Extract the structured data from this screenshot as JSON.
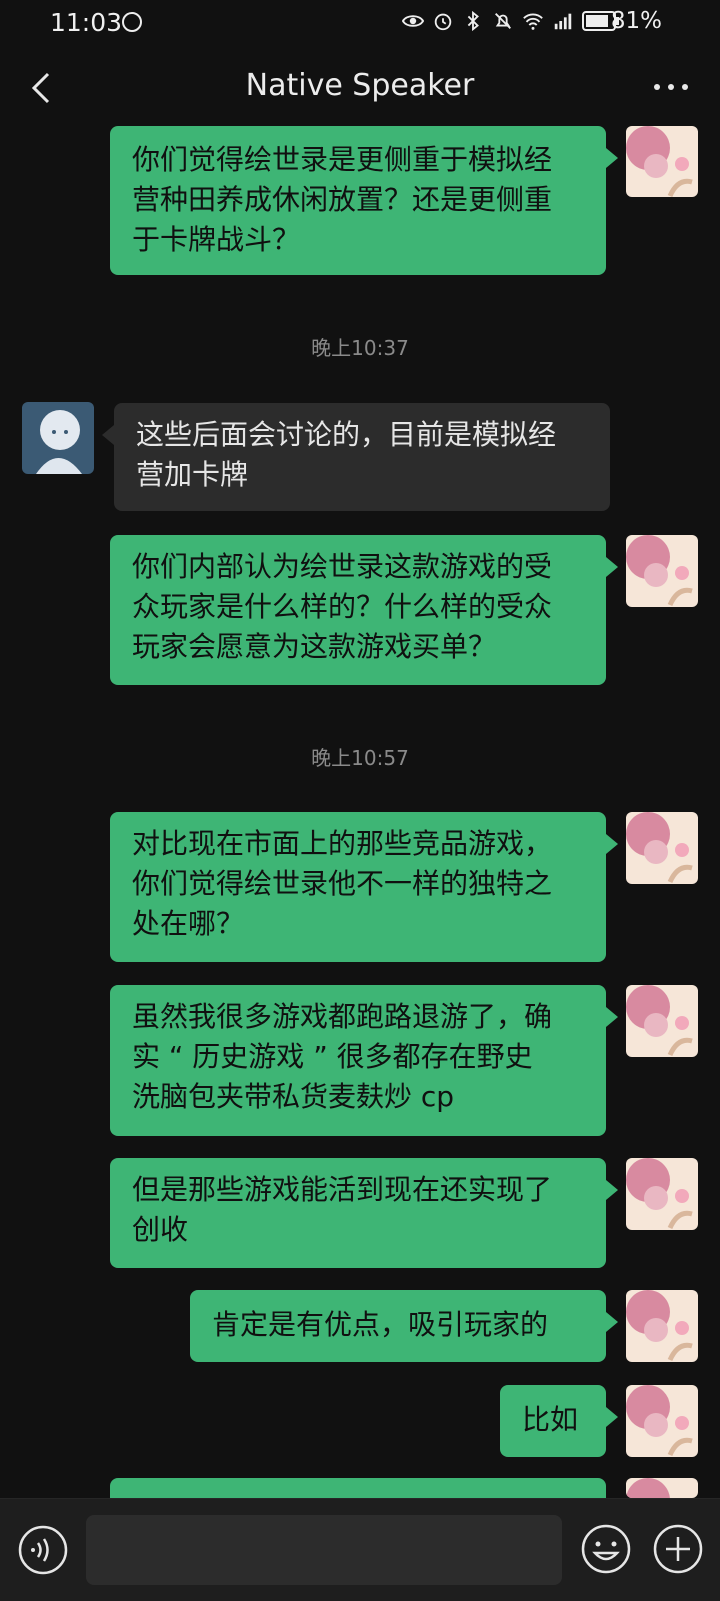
{
  "status_bar": {
    "time": "11:03",
    "battery": "81%"
  },
  "header": {
    "title": "Native Speaker"
  },
  "messages": [
    {
      "side": "right",
      "text": "你们觉得绘世录是更侧重于模拟经营种田养成休闲放置？还是更侧重于卡牌战斗？"
    },
    {
      "timestamp": "晚上10:37"
    },
    {
      "side": "left",
      "text": "这些后面会讨论的，目前是模拟经营加卡牌"
    },
    {
      "side": "right",
      "text": "你们内部认为绘世录这款游戏的受众玩家是什么样的？什么样的受众玩家会愿意为这款游戏买单？"
    },
    {
      "timestamp": "晚上10:57"
    },
    {
      "side": "right",
      "text": "对比现在市面上的那些竞品游戏，你们觉得绘世录他不一样的独特之处在哪？"
    },
    {
      "side": "right",
      "text": "虽然我很多游戏都跑路退游了，确实 “ 历史游戏 ” 很多都存在野史洗脑包夹带私货麦麸炒 cp"
    },
    {
      "side": "right",
      "text": "但是那些游戏能活到现在还实现了创收"
    },
    {
      "side": "right",
      "text": "肯定是有优点，吸引玩家的"
    },
    {
      "side": "right",
      "text": "比如"
    }
  ],
  "texts": {
    "m0": "你们觉得绘世录是更侧重于模拟经\n营种田养成休闲放置？还是更侧重\n于卡牌战斗？",
    "ts1": "晚上10:37",
    "m1": "这些后面会讨论的，目前是模拟经\n营加卡牌",
    "m2": "你们内部认为绘世录这款游戏的受\n众玩家是什么样的？什么样的受众\n玩家会愿意为这款游戏买单？",
    "ts2": "晚上10:57",
    "m3": "对比现在市面上的那些竞品游戏，\n你们觉得绘世录他不一样的独特之\n处在哪？",
    "m4": "虽然我很多游戏都跑路退游了，确\n实 “ 历史游戏 ” 很多都存在野史\n洗脑包夹带私货麦麸炒 cp",
    "m5": "但是那些游戏能活到现在还实现了\n创收",
    "m6": "肯定是有优点，吸引玩家的",
    "m7": "比如"
  },
  "colors": {
    "background": "#111111",
    "sent_bubble": "#3eb575",
    "received_bubble": "#2c2c2c",
    "input_bar": "#1e1e1e"
  },
  "icons": {
    "back": "chevron-left-icon",
    "more": "more-icon",
    "voice": "voice-icon",
    "emoji": "emoji-icon",
    "plus": "plus-icon"
  }
}
